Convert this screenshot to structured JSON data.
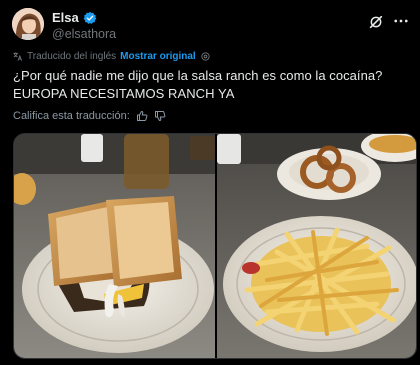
{
  "author": {
    "display_name": "Elsa",
    "handle": "@elsathora",
    "verified": true
  },
  "translation": {
    "label": "Traducido del inglés",
    "show_original": "Mostrar original"
  },
  "tweet": {
    "text": "¿Por qué nadie me dijo que la salsa ranch es como la cocaína? EUROPA NECESITAMOS RANCH YA"
  },
  "rate_translation": {
    "label": "Califica esta traducción:"
  },
  "media": [
    {
      "alt": "sandwich",
      "icon": "photo"
    },
    {
      "alt": "french fries and onion rings",
      "icon": "photo"
    }
  ],
  "colors": {
    "background": "#000000",
    "text": "#e7e9ea",
    "muted": "#71767b",
    "accent": "#1d9bf0"
  },
  "icons": {
    "verified": "verified-badge-icon",
    "grok": "grok-icon",
    "more": "more-icon",
    "translate": "translate-icon",
    "info": "info-icon",
    "thumbs_up": "thumbs-up-icon",
    "thumbs_down": "thumbs-down-icon"
  }
}
